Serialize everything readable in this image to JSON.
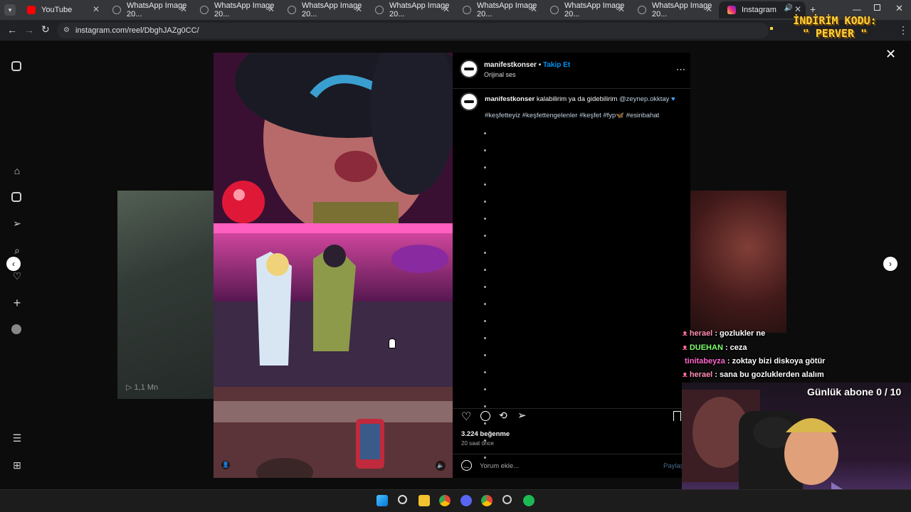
{
  "tabs": [
    {
      "title": "YouTube"
    },
    {
      "title": "WhatsApp Image 20..."
    },
    {
      "title": "WhatsApp Image 20..."
    },
    {
      "title": "WhatsApp Image 20..."
    },
    {
      "title": "WhatsApp Image 20..."
    },
    {
      "title": "WhatsApp Image 20..."
    },
    {
      "title": "WhatsApp Image 20..."
    },
    {
      "title": "WhatsApp Image 20..."
    },
    {
      "title": "Instagram"
    }
  ],
  "address": {
    "url": "instagram.com/reel/DbghJAZg0CC/"
  },
  "overlay": {
    "promo": "İNDİRİM KODU:\n\" PERVER \""
  },
  "post": {
    "username": "manifestkonser",
    "follow_label": "Takip Et",
    "separator": "•",
    "audio": "Orijinal ses",
    "caption_user": "manifestkonser",
    "caption_text": "kalabilirim ya da gidebilirim",
    "mention": "@zeynep.okktay",
    "hashtags": "#keşfetteyiz #keşfettengelenler #keşfet #fyp🦋 #esinbahat",
    "likes": "3.224 beğenme",
    "time": "20 saat önce",
    "comment_placeholder": "Yorum ekle...",
    "share_label": "Paylaş"
  },
  "bg_card_left": {
    "views": "1,1 Mn"
  },
  "chat": [
    {
      "user": "herael",
      "msg": ": gozlukler ne",
      "color": "#ff8fb1"
    },
    {
      "user": "DUEHAN",
      "msg": ": ceza",
      "color": "#7dff6b"
    },
    {
      "user": "tinitabeyza",
      "msg": ": zoktay bizi diskoya götür",
      "color": "#ff66cc"
    },
    {
      "user": "herael",
      "msg": ": sana bu gozluklerden alalım",
      "color": "#ff8fb1"
    }
  ],
  "subs": {
    "text": "Günlük abone 0 / 10"
  },
  "colors": {
    "accent": "#0095f6",
    "link": "#e0f1ff"
  }
}
